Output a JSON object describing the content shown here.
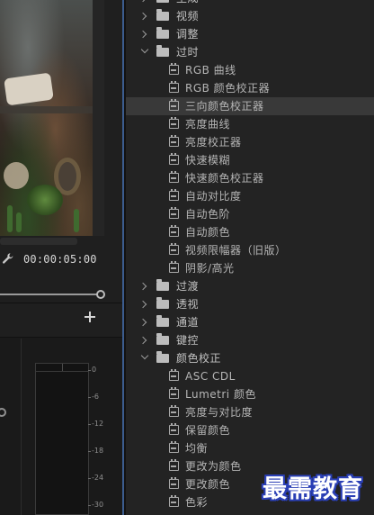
{
  "program_monitor": {
    "timecode": "00:00:05:00",
    "meter_ticks": [
      "0",
      "-6",
      "-12",
      "-18",
      "-24",
      "-30"
    ]
  },
  "effects": [
    {
      "type": "folder",
      "label": "生成",
      "expanded": false
    },
    {
      "type": "folder",
      "label": "视频",
      "expanded": false
    },
    {
      "type": "folder",
      "label": "调整",
      "expanded": false
    },
    {
      "type": "folder",
      "label": "过时",
      "expanded": true
    },
    {
      "type": "effect",
      "label": "RGB 曲线"
    },
    {
      "type": "effect",
      "label": "RGB 颜色校正器"
    },
    {
      "type": "effect",
      "label": "三向颜色校正器",
      "selected": true
    },
    {
      "type": "effect",
      "label": "亮度曲线"
    },
    {
      "type": "effect",
      "label": "亮度校正器"
    },
    {
      "type": "effect",
      "label": "快速模糊"
    },
    {
      "type": "effect",
      "label": "快速颜色校正器"
    },
    {
      "type": "effect",
      "label": "自动对比度"
    },
    {
      "type": "effect",
      "label": "自动色阶"
    },
    {
      "type": "effect",
      "label": "自动颜色"
    },
    {
      "type": "effect",
      "label": "视频限幅器（旧版）"
    },
    {
      "type": "effect",
      "label": "阴影/高光"
    },
    {
      "type": "folder",
      "label": "过渡",
      "expanded": false
    },
    {
      "type": "folder",
      "label": "透视",
      "expanded": false
    },
    {
      "type": "folder",
      "label": "通道",
      "expanded": false
    },
    {
      "type": "folder",
      "label": "键控",
      "expanded": false
    },
    {
      "type": "folder",
      "label": "颜色校正",
      "expanded": true
    },
    {
      "type": "effect",
      "label": "ASC CDL"
    },
    {
      "type": "effect",
      "label": "Lumetri 颜色"
    },
    {
      "type": "effect",
      "label": "亮度与对比度"
    },
    {
      "type": "effect",
      "label": "保留颜色"
    },
    {
      "type": "effect",
      "label": "均衡"
    },
    {
      "type": "effect",
      "label": "更改为颜色"
    },
    {
      "type": "effect",
      "label": "更改颜色"
    },
    {
      "type": "effect",
      "label": "色彩"
    }
  ],
  "watermark": "最需教育",
  "colors": {
    "selected_row": "#393939",
    "panel_bg": "#232323",
    "splitter_accent": "#3c5d8f",
    "watermark_outline": "#2a3fb5"
  }
}
